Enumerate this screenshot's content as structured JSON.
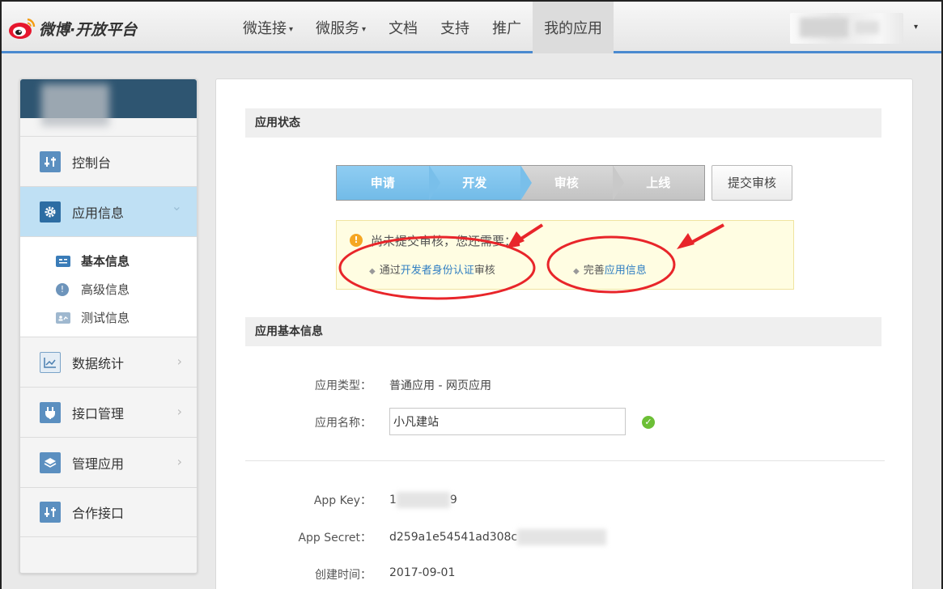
{
  "brand": {
    "logo_text": "微博·开放平台"
  },
  "nav": {
    "items": [
      {
        "label": "微连接",
        "caret": "▾"
      },
      {
        "label": "微服务",
        "caret": "▾"
      },
      {
        "label": "文档",
        "caret": ""
      },
      {
        "label": "支持",
        "caret": ""
      },
      {
        "label": "推广",
        "caret": ""
      },
      {
        "label": "我的应用",
        "caret": ""
      }
    ],
    "active": "我的应用",
    "user_caret": "▾"
  },
  "sidebar": {
    "items": [
      {
        "label": "控制台",
        "icon": "sliders-icon"
      },
      {
        "label": "应用信息",
        "icon": "gear-icon",
        "active": true,
        "arrow": "⌄"
      },
      {
        "label": "数据统计",
        "icon": "line-chart-icon",
        "arrow": "›"
      },
      {
        "label": "接口管理",
        "icon": "plug-icon",
        "arrow": "›"
      },
      {
        "label": "管理应用",
        "icon": "layers-icon",
        "arrow": "›"
      },
      {
        "label": "合作接口",
        "icon": "sliders-icon"
      }
    ],
    "sub_items": [
      {
        "label": "基本信息",
        "icon": "id-card-icon",
        "current": true
      },
      {
        "label": "高级信息",
        "icon": "exclamation-icon"
      },
      {
        "label": "测试信息",
        "icon": "user-card-icon"
      }
    ]
  },
  "status": {
    "section_title": "应用状态",
    "steps": [
      "申请",
      "开发",
      "审核",
      "上线"
    ],
    "steps_completed": 2,
    "submit_label": "提交审核",
    "notice": {
      "message": "尚未提交审核，您还需要：",
      "req1_prefix": "通过",
      "req1_link": "开发者身份认证",
      "req1_suffix": "审核",
      "req2_prefix": "完善",
      "req2_link": "应用信息"
    }
  },
  "basic": {
    "section_title": "应用基本信息",
    "type_label": "应用类型：",
    "type_value": "普通应用 - 网页应用",
    "name_label": "应用名称：",
    "name_value": "小凡建站",
    "key_label": "App Key：",
    "key_value_start": "1",
    "key_value_end": "9",
    "secret_label": "App Secret：",
    "secret_value": "d259a1e54541ad308c",
    "created_label": "创建时间：",
    "created_value": "2017-09-01"
  },
  "colors": {
    "nav_border": "#4a8ad0",
    "sidebar_header": "#2e5571",
    "sidebar_active": "#bfe0f4",
    "step_done": "#80c4ee",
    "step_todo": "#cccccc",
    "link": "#2f7ec2",
    "annotation": "#e8252a"
  }
}
